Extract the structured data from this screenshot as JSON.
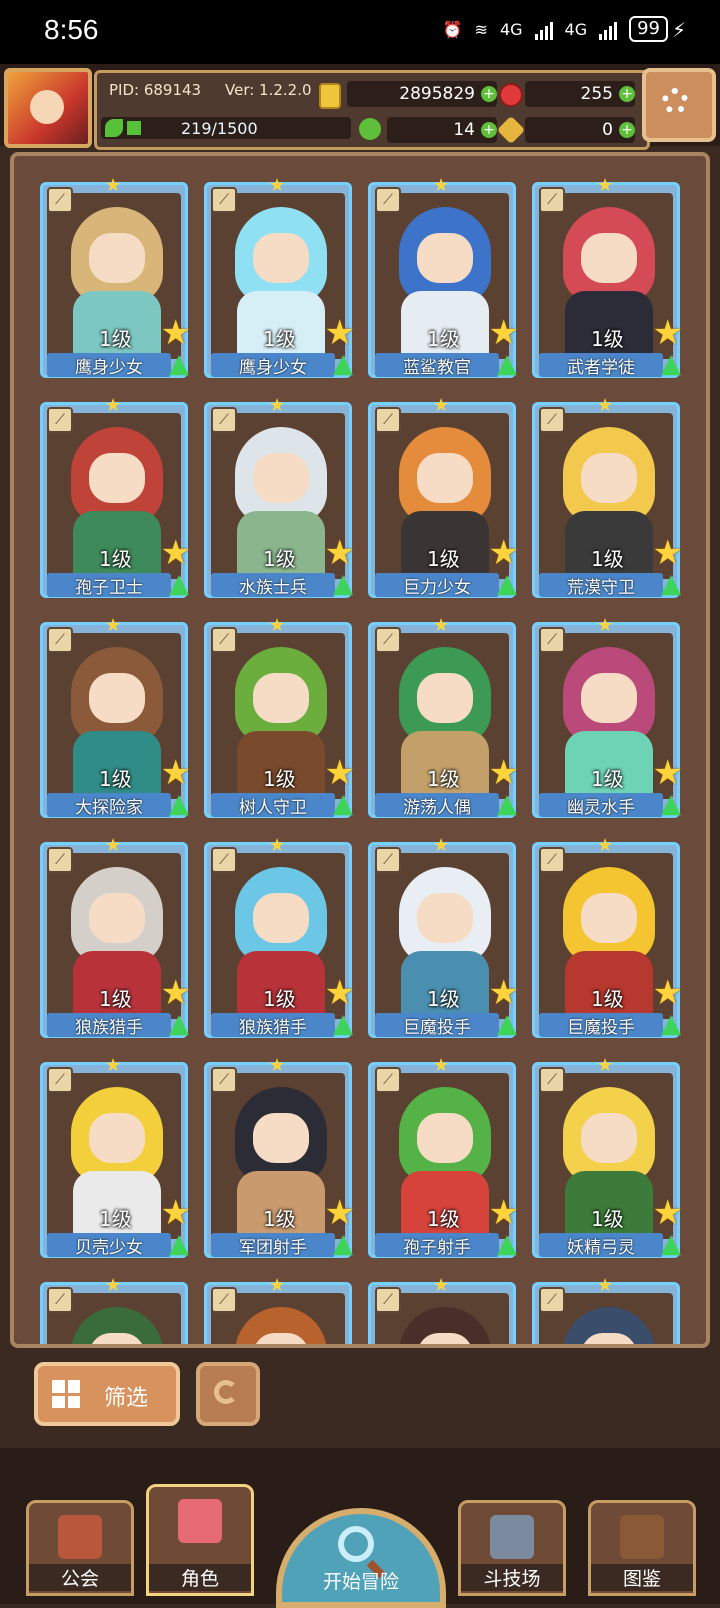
{
  "status_bar": {
    "time": "8:56",
    "net1": "4G",
    "net2": "4G",
    "battery": "99"
  },
  "header": {
    "pid": "PID: 689143",
    "version": "Ver: 1.2.2.0",
    "gold": "2895829",
    "gems": "255",
    "stamina": "219/1500",
    "clover": "14",
    "keys": "0"
  },
  "cards": [
    {
      "name": "鹰身少女",
      "level": "1级",
      "hair": "#d8b67a",
      "body": "#7dc7c2"
    },
    {
      "name": "鹰身少女",
      "level": "1级",
      "hair": "#8fe0f2",
      "body": "#d6eef5"
    },
    {
      "name": "蓝鲨教官",
      "level": "1级",
      "hair": "#3d73c9",
      "body": "#e6edf2"
    },
    {
      "name": "武者学徒",
      "level": "1级",
      "hair": "#d44a55",
      "body": "#2c2c38"
    },
    {
      "name": "孢子卫士",
      "level": "1级",
      "hair": "#c0433a",
      "body": "#3e8a5a"
    },
    {
      "name": "水族士兵",
      "level": "1级",
      "hair": "#dde5ea",
      "body": "#8ab58d"
    },
    {
      "name": "巨力少女",
      "level": "1级",
      "hair": "#e58b3c",
      "body": "#3b3434"
    },
    {
      "name": "荒漠守卫",
      "level": "1级",
      "hair": "#f2c94c",
      "body": "#3a3a3a"
    },
    {
      "name": "大探险家",
      "level": "1级",
      "hair": "#8a5a3a",
      "body": "#2f8c86"
    },
    {
      "name": "树人守卫",
      "level": "1级",
      "hair": "#6cae3d",
      "body": "#7a4a2d"
    },
    {
      "name": "游荡人偶",
      "level": "1级",
      "hair": "#3d9a55",
      "body": "#c3a06a"
    },
    {
      "name": "幽灵水手",
      "level": "1级",
      "hair": "#b94a7a",
      "body": "#6ed3b4"
    },
    {
      "name": "狼族猎手",
      "level": "1级",
      "hair": "#d5cfca",
      "body": "#b8323a"
    },
    {
      "name": "狼族猎手",
      "level": "1级",
      "hair": "#6cc6e6",
      "body": "#b8323a"
    },
    {
      "name": "巨魔投手",
      "level": "1级",
      "hair": "#e9eef4",
      "body": "#4a8fb0"
    },
    {
      "name": "巨魔投手",
      "level": "1级",
      "hair": "#f5c431",
      "body": "#b6382e"
    },
    {
      "name": "贝壳少女",
      "level": "1级",
      "hair": "#f3cf3b",
      "body": "#eaeaea"
    },
    {
      "name": "军团射手",
      "level": "1级",
      "hair": "#2c2c36",
      "body": "#c99a6e"
    },
    {
      "name": "孢子射手",
      "level": "1级",
      "hair": "#54b247",
      "body": "#d5433b"
    },
    {
      "name": "妖精弓灵",
      "level": "1级",
      "hair": "#f3d14b",
      "body": "#3c7b39"
    },
    {
      "name": "",
      "level": "",
      "hair": "#3a6b3a",
      "body": "#2e2e2e"
    },
    {
      "name": "",
      "level": "",
      "hair": "#b8622e",
      "body": "#5a3a2a"
    },
    {
      "name": "",
      "level": "",
      "hair": "#4a2e2a",
      "body": "#4a2e2a"
    },
    {
      "name": "",
      "level": "",
      "hair": "#3a4d6a",
      "body": "#2e2e3e"
    }
  ],
  "filter_label": "筛选",
  "nav": {
    "guild": "公会",
    "character": "角色",
    "adventure": "开始冒险",
    "arena": "斗技场",
    "codex": "图鉴"
  }
}
